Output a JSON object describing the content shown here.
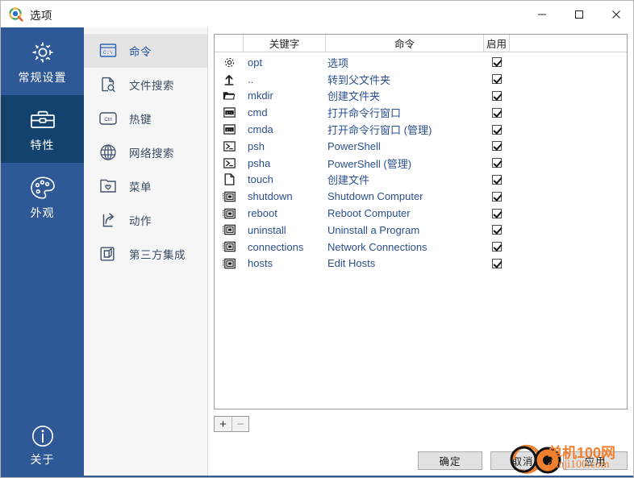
{
  "window": {
    "title": "选项",
    "app_icon": "listary-magnifier-icon",
    "controls": {
      "minimize": "minimize-icon",
      "maximize": "maximize-icon",
      "close": "close-icon"
    }
  },
  "rail": {
    "items": [
      {
        "label": "常规设置",
        "icon": "gear-icon",
        "active": false
      },
      {
        "label": "特性",
        "icon": "toolbox-icon",
        "active": true
      },
      {
        "label": "外观",
        "icon": "palette-icon",
        "active": false
      }
    ],
    "bottom": {
      "label": "关于",
      "icon": "info-circle-icon"
    }
  },
  "nav": {
    "items": [
      {
        "label": "命令",
        "icon": "console-window-icon",
        "active": true
      },
      {
        "label": "文件搜索",
        "icon": "file-search-icon",
        "active": false
      },
      {
        "label": "热键",
        "icon": "ctrl-key-icon",
        "active": false
      },
      {
        "label": "网络搜索",
        "icon": "globe-icon",
        "active": false
      },
      {
        "label": "菜单",
        "icon": "folder-heart-icon",
        "active": false
      },
      {
        "label": "动作",
        "icon": "share-arrow-icon",
        "active": false
      },
      {
        "label": "第三方集成",
        "icon": "windows-copy-icon",
        "active": false
      }
    ]
  },
  "table": {
    "columns": [
      {
        "key": "icon",
        "label": ""
      },
      {
        "key": "keyword",
        "label": "关键字"
      },
      {
        "key": "command",
        "label": "命令"
      },
      {
        "key": "enabled",
        "label": "启用"
      },
      {
        "key": "rest",
        "label": ""
      }
    ],
    "rows": [
      {
        "icon": "gear-icon",
        "keyword": "opt",
        "command": "选项",
        "enabled": true
      },
      {
        "icon": "arrow-up-bar-icon",
        "keyword": "..",
        "command": "转到父文件夹",
        "enabled": true
      },
      {
        "icon": "folder-icon",
        "keyword": "mkdir",
        "command": "创建文件夹",
        "enabled": true
      },
      {
        "icon": "cmd-icon",
        "keyword": "cmd",
        "command": "打开命令行窗口",
        "enabled": true
      },
      {
        "icon": "cmd-icon",
        "keyword": "cmda",
        "command": "打开命令行窗口 (管理)",
        "enabled": true
      },
      {
        "icon": "powershell-icon",
        "keyword": "psh",
        "command": "PowerShell",
        "enabled": true
      },
      {
        "icon": "powershell-icon",
        "keyword": "psha",
        "command": "PowerShell (管理)",
        "enabled": true
      },
      {
        "icon": "document-icon",
        "keyword": "touch",
        "command": "创建文件",
        "enabled": true
      },
      {
        "icon": "cpl-applet-icon",
        "keyword": "shutdown",
        "command": "Shutdown Computer",
        "enabled": true
      },
      {
        "icon": "cpl-applet-icon",
        "keyword": "reboot",
        "command": "Reboot Computer",
        "enabled": true
      },
      {
        "icon": "cpl-applet-icon",
        "keyword": "uninstall",
        "command": "Uninstall a Program",
        "enabled": true
      },
      {
        "icon": "cpl-applet-icon",
        "keyword": "connections",
        "command": "Network Connections",
        "enabled": true
      },
      {
        "icon": "cpl-applet-icon",
        "keyword": "hosts",
        "command": "Edit Hosts",
        "enabled": true
      }
    ]
  },
  "list_tools": {
    "add_label": "+",
    "remove_label": "−"
  },
  "dialog_buttons": {
    "ok": "确定",
    "cancel": "取消",
    "apply": "应用"
  },
  "watermark": {
    "main": "单机100网",
    "sub": "danji100.com",
    "color": "#f08030"
  },
  "colors": {
    "rail_bg": "#2e5896",
    "rail_active": "#13426f",
    "nav_bg": "#f6f6f6",
    "nav_active": "#e4e4e4",
    "link_blue": "#2b4f8e"
  }
}
